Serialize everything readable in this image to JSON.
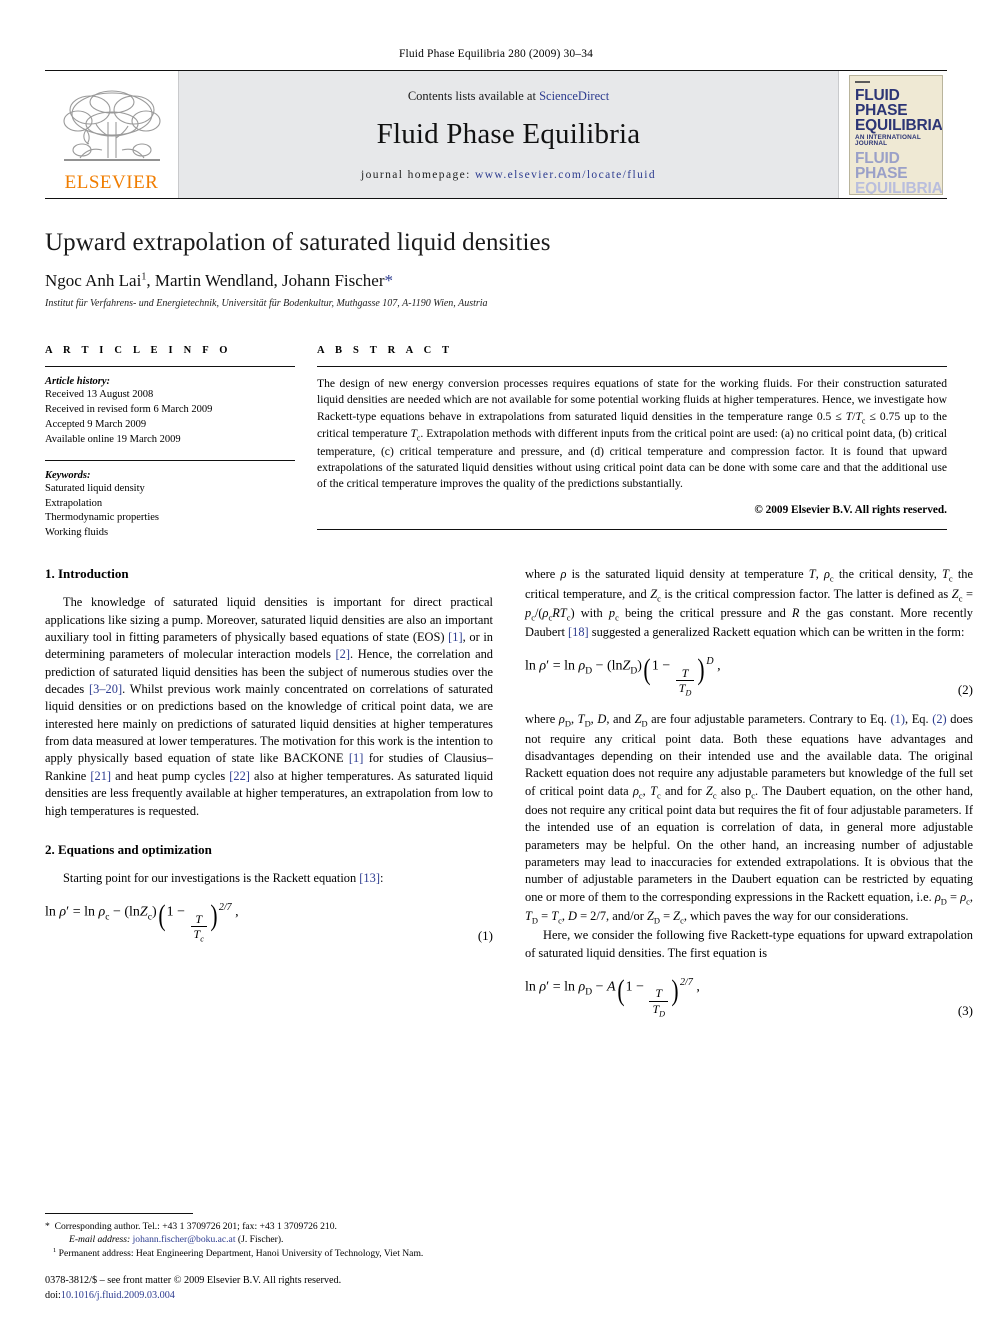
{
  "running_head": "Fluid Phase Equilibria 280 (2009) 30–34",
  "masthead": {
    "publisher_wordmark": "ELSEVIER",
    "contents_line_prefix": "Contents lists available at ",
    "contents_link": "ScienceDirect",
    "journal_title": "Fluid Phase Equilibria",
    "homepage_prefix": "journal homepage: ",
    "homepage_url": "www.elsevier.com/locate/fluid",
    "cover": {
      "line1": "FLUID PHASE",
      "line2": "EQUILIBRIA",
      "line3": "AN INTERNATIONAL JOURNAL",
      "line4": "FLUID PHASE",
      "line5": "EQUILIBRIA"
    },
    "link_color": "#2c3b8f",
    "banner_bg": "#e7e8ea",
    "elsevier_orange": "#F07D00"
  },
  "article": {
    "title": "Upward extrapolation of saturated liquid densities",
    "authors_html": "Ngoc Anh Lai<sup>1</sup>, Martin Wendland, Johann Fischer<span class=\"star\">*</span>",
    "affiliation": "Institut für Verfahrens- und Energietechnik, Universität für Bodenkultur, Muthgasse 107, A-1190 Wien, Austria"
  },
  "info": {
    "heading": "A R T I C L E    I N F O",
    "history_label": "Article history:",
    "history": [
      "Received 13 August 2008",
      "Received in revised form 6 March 2009",
      "Accepted 9 March 2009",
      "Available online 19 March 2009"
    ],
    "keywords_label": "Keywords:",
    "keywords": [
      "Saturated liquid density",
      "Extrapolation",
      "Thermodynamic properties",
      "Working fluids"
    ]
  },
  "abstract": {
    "heading": "A B S T R A C T",
    "text_html": "The design of new energy conversion processes requires equations of state for the working fluids. For their construction saturated liquid densities are needed which are not available for some potential working fluids at higher temperatures. Hence, we investigate how Rackett-type equations behave in extrapolations from saturated liquid densities in the temperature range 0.5 ≤ <span class=\"mi\">T</span>/<span class=\"mi\">T</span><sub>c</sub> ≤ 0.75 up to the critical temperature <span class=\"mi\">T</span><sub>c</sub>. Extrapolation methods with different inputs from the critical point are used: (a) no critical point data, (b) critical temperature, (c) critical temperature and pressure, and (d) critical temperature and compression factor. It is found that upward extrapolations of the saturated liquid densities without using critical point data can be done with some care and that the additional use of the critical temperature improves the quality of the predictions substantially.",
    "copyright": "© 2009 Elsevier B.V. All rights reserved."
  },
  "body": {
    "section1_title": "1.  Introduction",
    "section1_p1_html": "The knowledge of saturated liquid densities is important for direct practical applications like sizing a pump. Moreover, saturated liquid densities are also an important auxiliary tool in fitting parameters of physically based equations of state (EOS) <span class=\"ref\">[1]</span>, or in determining parameters of molecular interaction models <span class=\"ref\">[2]</span>. Hence, the correlation and prediction of saturated liquid densities has been the subject of numerous studies over the decades <span class=\"ref\">[3–20]</span>. Whilst previous work mainly concentrated on correlations of saturated liquid densities or on predictions based on the knowledge of critical point data, we are interested here mainly on predictions of saturated liquid densities at higher temperatures from data measured at lower temperatures. The motivation for this work is the intention to apply physically based equation of state like BACKONE <span class=\"ref\">[1]</span> for studies of Clausius–Rankine <span class=\"ref\">[21]</span> and heat pump cycles <span class=\"ref\">[22]</span> also at higher temperatures. As saturated liquid densities are less frequently available at higher temperatures, an extrapolation from low to high temperatures is requested.",
    "section2_title": "2.  Equations and optimization",
    "section2_p1_html": "Starting point for our investigations is the Rackett equation <span class=\"ref\">[13]</span>:",
    "eq1_number": "(1)",
    "eq2_number": "(2)",
    "eq3_number": "(3)",
    "right_p1_html": "where  <span class=\"mi\">ρ</span> is the saturated liquid density at temperature <span class=\"mi\">T</span>, <span class=\"mi\">ρ</span><sub>c</sub> the critical density, <span class=\"mi\">T</span><sub>c</sub> the critical temperature, and <span class=\"mi\">Z</span><sub>c</sub> is the critical compression factor. The latter is defined as <span class=\"mi\">Z</span><sub>c</sub> = <span class=\"mi\">p</span><sub>c</sub>/(<span class=\"mi\">ρ</span><sub>c</sub><span class=\"mi\">RT</span><sub>c</sub>) with <span class=\"mi\">p</span><sub>c</sub> being the critical pressure and <span class=\"mi\">R</span> the gas constant. More recently Daubert <span class=\"ref\">[18]</span> suggested a generalized Rackett equation which can be written in the form:",
    "right_p2_html": "where <span class=\"mi\">ρ</span><sub>D</sub>, <span class=\"mi\">T</span><sub>D</sub>, <span class=\"mi\">D</span>, and <span class=\"mi\">Z</span><sub>D</sub> are four adjustable parameters. Contrary to Eq. <span class=\"ref\">(1)</span>, Eq. <span class=\"ref\">(2)</span> does not require any critical point data. Both these equations have advantages and disadvantages depending on their intended use and the available data. The original Rackett equation does not require any adjustable parameters but knowledge of the full set of critical point data <span class=\"mi\">ρ</span><sub>c</sub>, <span class=\"mi\">T</span><sub>c</sub> and for <span class=\"mi\">Z</span><sub>c</sub> also p<sub>c</sub>. The Daubert equation, on the other hand, does not require any critical point data but requires the fit of four adjustable parameters. If the intended use of an equation is correlation of data, in general more adjustable parameters may be helpful. On the other hand, an increasing number of adjustable parameters may lead to inaccuracies for extended extrapolations. It is obvious that the number of adjustable parameters in the Daubert equation can be restricted by equating one or more of them to the corresponding expressions in the Rackett equation, i.e. <span class=\"mi\">ρ</span><sub>D</sub> = <span class=\"mi\">ρ</span><sub>c</sub>, <span class=\"mi\">T</span><sub>D</sub> = <span class=\"mi\">T</span><sub>c</sub>, <span class=\"mi\">D</span> = 2/7, and/or <span class=\"mi\">Z</span><sub>D</sub> = <span class=\"mi\">Z</span><sub>c</sub>, which paves the way for our considerations.",
    "right_p3_html": "Here, we consider the following five Rackett-type equations for upward extrapolation of saturated liquid densities. The first equation is"
  },
  "footnotes": {
    "corresponding_html": "<span style=\"letter-spacing:0\">*</span>&nbsp; Corresponding author. Tel.: +43 1 3709726 201; fax: +43 1 3709726 210.",
    "email_label": "E-mail address:",
    "email": "johann.fischer@boku.ac.at",
    "email_suffix": "(J. Fischer).",
    "permanent_html": "<sup>1</sup> Permanent address: Heat Engineering Department, Hanoi University of Technology, Viet Nam.",
    "imprint": "0378-3812/$ – see front matter © 2009 Elsevier B.V. All rights reserved.",
    "doi_label": "doi:",
    "doi": "10.1016/j.fluid.2009.03.004"
  }
}
